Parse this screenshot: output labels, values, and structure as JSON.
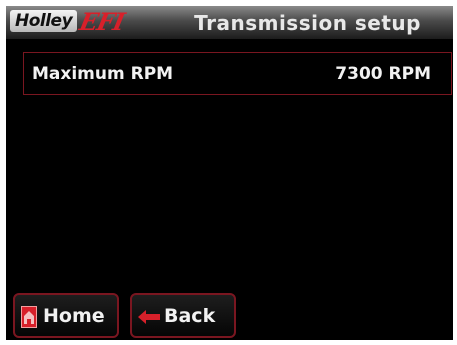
{
  "header": {
    "brand_name": "Holley",
    "brand_suffix": "EFI",
    "title": "Transmission setup"
  },
  "settings": [
    {
      "label": "Maximum RPM",
      "value": "7300 RPM"
    }
  ],
  "footer": {
    "home_label": "Home",
    "back_label": "Back"
  },
  "colors": {
    "background": "#000000",
    "accent_red": "#d8202a",
    "border_red": "#7a1620",
    "text": "#f2f2f2"
  },
  "icons": {
    "home": "home-icon",
    "back": "back-arrow-icon"
  }
}
